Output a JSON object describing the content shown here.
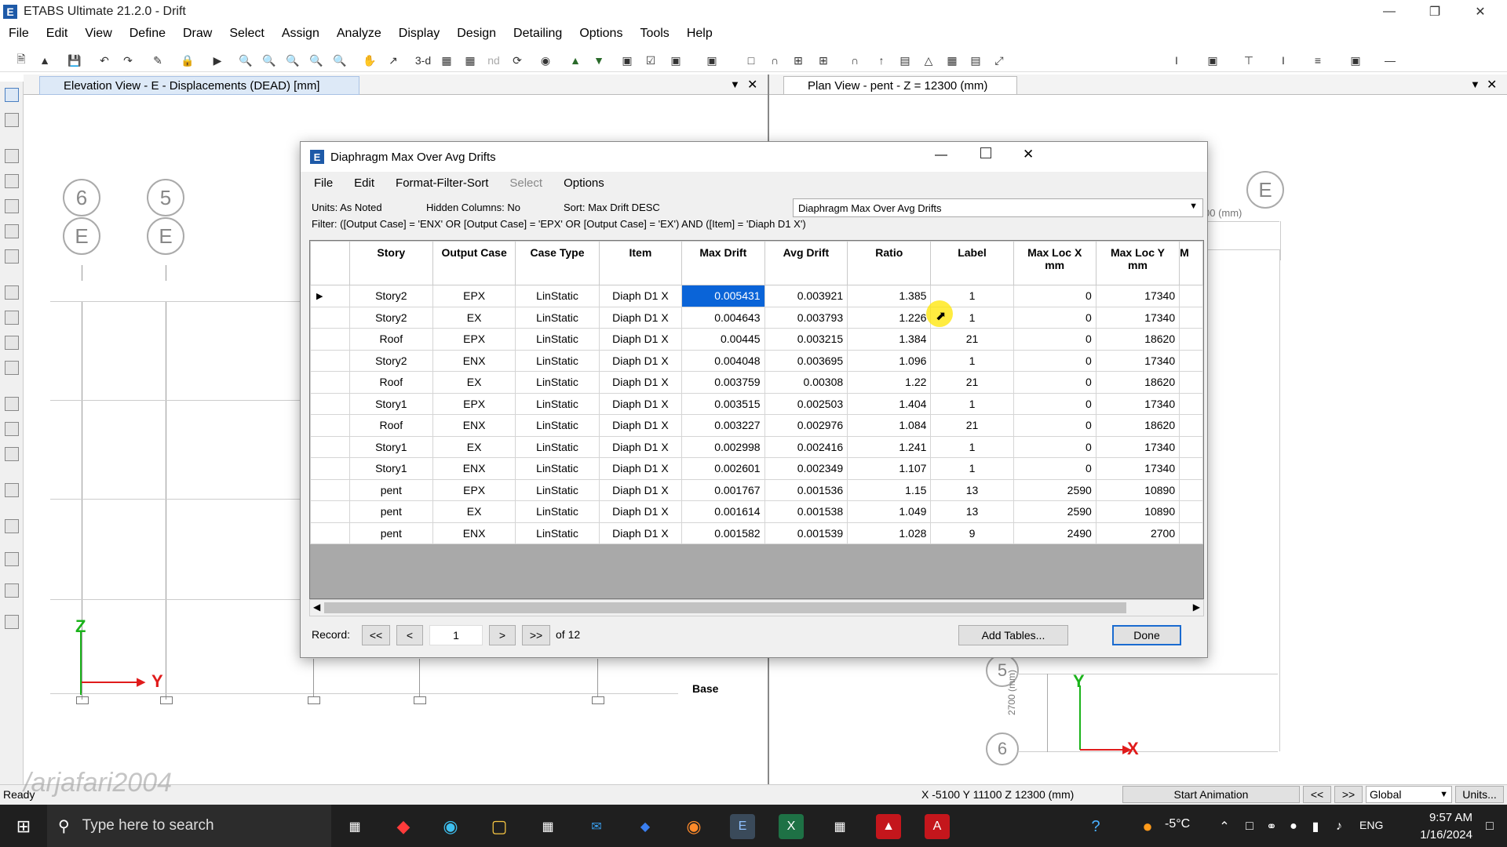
{
  "app": {
    "title": "ETABS Ultimate 21.2.0 - Drift"
  },
  "menu": [
    "File",
    "Edit",
    "View",
    "Define",
    "Draw",
    "Select",
    "Assign",
    "Analyze",
    "Display",
    "Design",
    "Detailing",
    "Options",
    "Tools",
    "Help"
  ],
  "toolbar": {
    "three_d": "3-d",
    "nd": "nd"
  },
  "panes": {
    "left_title": "Elevation View - E  - Displacements (DEAD)  [mm]",
    "right_title": "Plan View - pent - Z = 12300 (mm)",
    "left_grid": [
      "6",
      "5"
    ],
    "left_grid_letter": "E",
    "base_label": "Base",
    "axis_z": "Z",
    "axis_y": "Y",
    "axis_x": "X",
    "right_grid_letter": "E",
    "right_grid_5": "5",
    "right_grid_6": "6",
    "right_dim": "2700 (mm)",
    "right_dim_top": "00 (mm)"
  },
  "dialog": {
    "title": "Diaphragm Max Over Avg Drifts",
    "menu": {
      "file": "File",
      "edit": "Edit",
      "format": "Format-Filter-Sort",
      "select": "Select",
      "options": "Options"
    },
    "units": "Units:  As Noted",
    "hidden": "Hidden Columns:  No",
    "sort": "Sort:  Max Drift DESC",
    "table_select": "Diaphragm Max Over Avg Drifts",
    "filter": "Filter:  ([Output Case] = 'ENX' OR [Output Case] = 'EPX' OR [Output Case] = 'EX') AND ([Item] = 'Diaph D1 X')",
    "columns": [
      "Story",
      "Output Case",
      "Case Type",
      "Item",
      "Max Drift",
      "Avg Drift",
      "Ratio",
      "Label",
      "Max Loc X\nmm",
      "Max Loc Y\nmm",
      "M"
    ],
    "rows": [
      [
        "Story2",
        "EPX",
        "LinStatic",
        "Diaph D1 X",
        "0.005431",
        "0.003921",
        "1.385",
        "1",
        "0",
        "17340"
      ],
      [
        "Story2",
        "EX",
        "LinStatic",
        "Diaph D1 X",
        "0.004643",
        "0.003793",
        "1.226",
        "1",
        "0",
        "17340"
      ],
      [
        "Roof",
        "EPX",
        "LinStatic",
        "Diaph D1 X",
        "0.00445",
        "0.003215",
        "1.384",
        "21",
        "0",
        "18620"
      ],
      [
        "Story2",
        "ENX",
        "LinStatic",
        "Diaph D1 X",
        "0.004048",
        "0.003695",
        "1.096",
        "1",
        "0",
        "17340"
      ],
      [
        "Roof",
        "EX",
        "LinStatic",
        "Diaph D1 X",
        "0.003759",
        "0.00308",
        "1.22",
        "21",
        "0",
        "18620"
      ],
      [
        "Story1",
        "EPX",
        "LinStatic",
        "Diaph D1 X",
        "0.003515",
        "0.002503",
        "1.404",
        "1",
        "0",
        "17340"
      ],
      [
        "Roof",
        "ENX",
        "LinStatic",
        "Diaph D1 X",
        "0.003227",
        "0.002976",
        "1.084",
        "21",
        "0",
        "18620"
      ],
      [
        "Story1",
        "EX",
        "LinStatic",
        "Diaph D1 X",
        "0.002998",
        "0.002416",
        "1.241",
        "1",
        "0",
        "17340"
      ],
      [
        "Story1",
        "ENX",
        "LinStatic",
        "Diaph D1 X",
        "0.002601",
        "0.002349",
        "1.107",
        "1",
        "0",
        "17340"
      ],
      [
        "pent",
        "EPX",
        "LinStatic",
        "Diaph D1 X",
        "0.001767",
        "0.001536",
        "1.15",
        "13",
        "2590",
        "10890"
      ],
      [
        "pent",
        "EX",
        "LinStatic",
        "Diaph D1 X",
        "0.001614",
        "0.001538",
        "1.049",
        "13",
        "2590",
        "10890"
      ],
      [
        "pent",
        "ENX",
        "LinStatic",
        "Diaph D1 X",
        "0.001582",
        "0.001539",
        "1.028",
        "9",
        "2490",
        "2700"
      ]
    ],
    "record_label": "Record:",
    "record_first": "<<",
    "record_prev": "<",
    "record_value": "1",
    "record_next": ">",
    "record_last": ">>",
    "record_of": "of 12",
    "add_tables": "Add Tables...",
    "done": "Done"
  },
  "status": {
    "ready": "Ready",
    "watermark": "/arjafari2004",
    "coords": "X -5100  Y 11100  Z 12300 (mm)",
    "start_animation": "Start Animation",
    "prev": "<<",
    "next": ">>",
    "coord_sys": "Global",
    "units": "Units..."
  },
  "taskbar": {
    "search": "Type here to search",
    "temp": "-5°C",
    "lang": "ENG",
    "time": "9:57 AM",
    "date": "1/16/2024"
  }
}
